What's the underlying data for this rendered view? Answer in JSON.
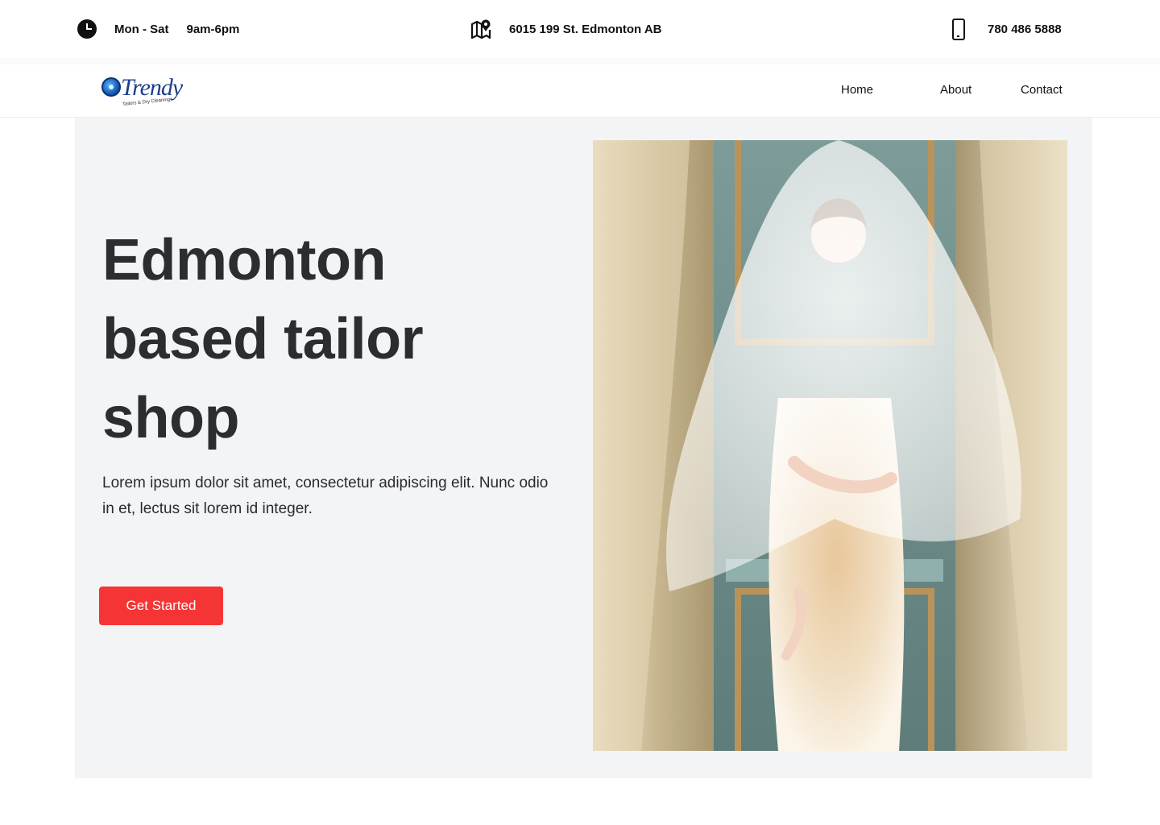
{
  "topbar": {
    "days": "Mon - Sat",
    "hours": "9am-6pm",
    "address": "6015 199 St. Edmonton AB",
    "phone": "780 486 5888"
  },
  "brand": {
    "name": "Trendy",
    "tagline": "Tailors & Dry Cleaning"
  },
  "nav": {
    "home": "Home",
    "about": "About",
    "contact": "Contact"
  },
  "hero": {
    "title": "Edmonton based tailor shop",
    "body": "Lorem ipsum dolor sit amet, consectetur adipiscing elit. Nunc odio in et, lectus sit lorem id integer.",
    "cta": "Get Started"
  },
  "colors": {
    "accent": "#f53535",
    "heading": "#2c2d31",
    "hero_bg": "#f3f4f6"
  },
  "icons": {
    "hours": "clock-icon",
    "address": "map-pin-icon",
    "phone": "phone-icon"
  }
}
